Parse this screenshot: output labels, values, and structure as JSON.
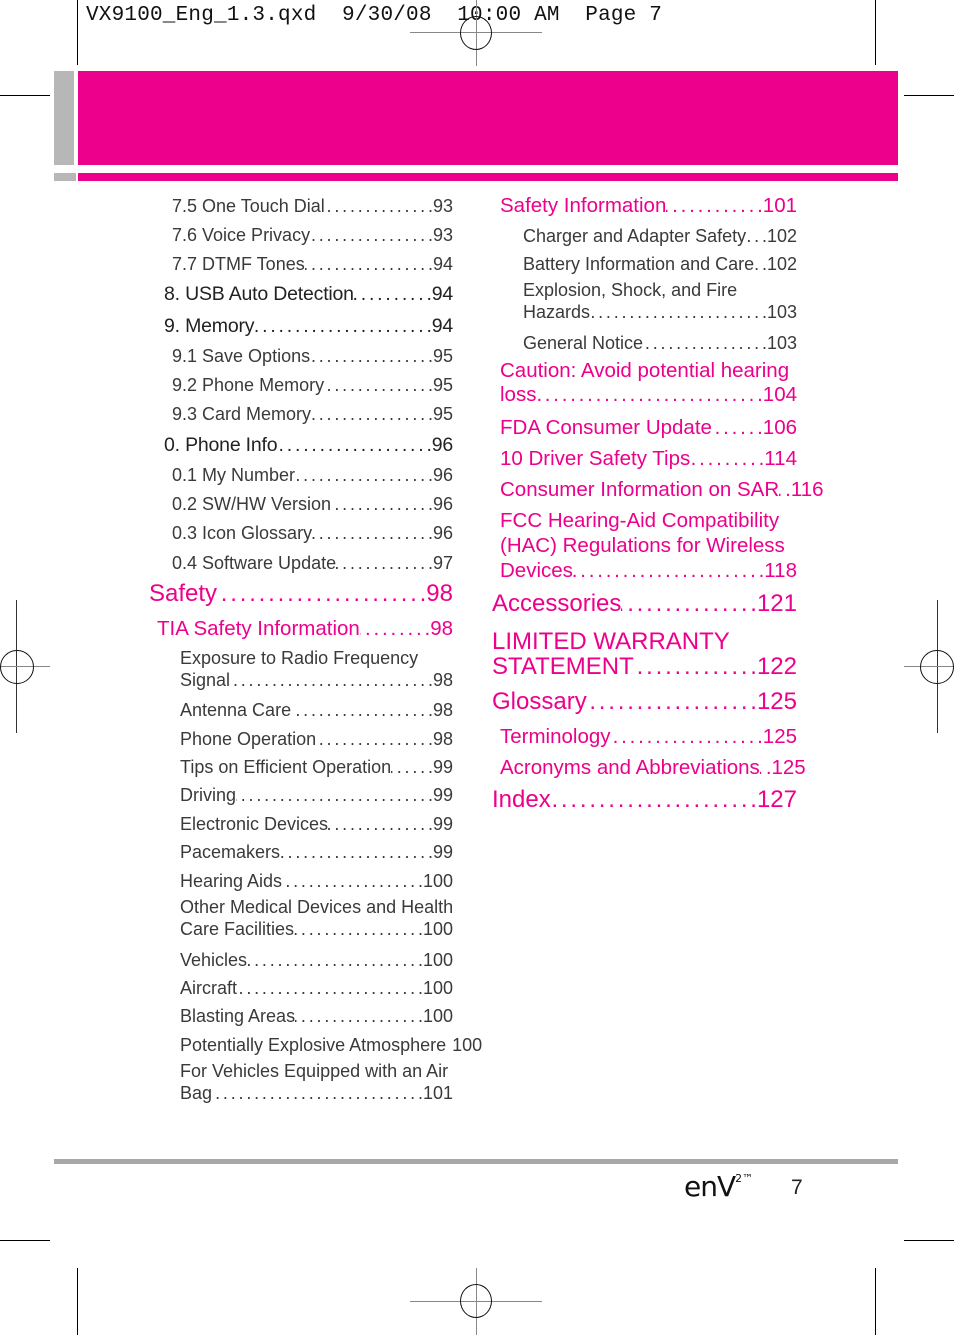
{
  "slug": "VX9100_Eng_1.3.qxd  9/30/08  10:00 AM  Page 7",
  "colors": {
    "accent": "#ec008c",
    "band_gray": "#b7b7b7",
    "footer_rule": "#a8a8a8"
  },
  "left_column": [
    {
      "title": "7.5 One Touch Dial",
      "page": ".93"
    },
    {
      "title": "7.6 Voice Privacy",
      "page": ".93"
    },
    {
      "title": "7.7 DTMF Tones",
      "page": ".94"
    },
    {
      "title": "8. USB Auto Detection",
      "page": ".94"
    },
    {
      "title": "9. Memory",
      "page": ".94"
    },
    {
      "title": "9.1 Save Options",
      "page": ".95"
    },
    {
      "title": "9.2 Phone Memory",
      "page": ".95"
    },
    {
      "title": "9.3 Card Memory",
      "page": ".95"
    },
    {
      "title": "0. Phone Info",
      "page": ".96"
    },
    {
      "title": "0.1 My Number",
      "page": ".96"
    },
    {
      "title": "0.2 SW/HW Version",
      "page": ".96"
    },
    {
      "title": "0.3 Icon Glossary",
      "page": ".96"
    },
    {
      "title": "0.4 Software Update",
      "page": ".97"
    },
    {
      "title": "Safety",
      "page": ".98"
    },
    {
      "title": "TIA Safety Information",
      "page": ".98"
    },
    {
      "title_line1": "Exposure to Radio Frequency",
      "title": "Signal",
      "page": ".98"
    },
    {
      "title": "Antenna Care",
      "page": ".98"
    },
    {
      "title": "Phone Operation",
      "page": ".98"
    },
    {
      "title": "Tips on Efficient Operation",
      "page": ".99"
    },
    {
      "title": "Driving",
      "page": ".99"
    },
    {
      "title": "Electronic Devices",
      "page": ".99"
    },
    {
      "title": "Pacemakers",
      "page": ".99"
    },
    {
      "title": "Hearing Aids",
      "page": ".100"
    },
    {
      "title_line1": "Other Medical Devices and Health",
      "title": "Care Facilities",
      "page": ".100"
    },
    {
      "title": "Vehicles",
      "page": ".100"
    },
    {
      "title": "Aircraft",
      "page": ".100"
    },
    {
      "title": "Blasting Areas",
      "page": ".100"
    },
    {
      "title": "Potentially Explosive Atmosphere",
      "page": "100"
    },
    {
      "title_line1": "For Vehicles Equipped with an Air",
      "title": "Bag",
      "page": ".101"
    }
  ],
  "right_column": [
    {
      "title": "Safety Information",
      "page": ".101"
    },
    {
      "title": "Charger and Adapter Safety",
      "page": ".102"
    },
    {
      "title": "Battery Information and Care",
      "page": ".102"
    },
    {
      "title_line1": "Explosion, Shock, and Fire",
      "title": "Hazards",
      "page": ".103"
    },
    {
      "title": "General Notice",
      "page": ".103"
    },
    {
      "title_line1": "Caution: Avoid potential hearing",
      "title": "loss.",
      "page": ".104"
    },
    {
      "title": "FDA Consumer Update",
      "page": ".106"
    },
    {
      "title": "10 Driver Safety Tips",
      "page": ".114"
    },
    {
      "title": "Consumer Information on SAR",
      "page": ".116"
    },
    {
      "title_line1": "FCC Hearing-Aid Compatibility",
      "title_line2": "(HAC) Regulations for Wireless",
      "title": "Devices",
      "page": ".118"
    },
    {
      "title": "Accessories",
      "page": ".121"
    },
    {
      "title_line1": "LIMITED WARRANTY",
      "title": "STATEMENT",
      "page": ".122"
    },
    {
      "title": "Glossary",
      "page": ".125"
    },
    {
      "title": "Terminology",
      "page": ".125"
    },
    {
      "title": "Acronyms and Abbreviations",
      "page": ".125"
    },
    {
      "title": "Index",
      "page": ".127"
    }
  ],
  "footer": {
    "logo_text": "enV",
    "logo_sup": "2™",
    "page_number": "7"
  },
  "leader": "............................................................"
}
